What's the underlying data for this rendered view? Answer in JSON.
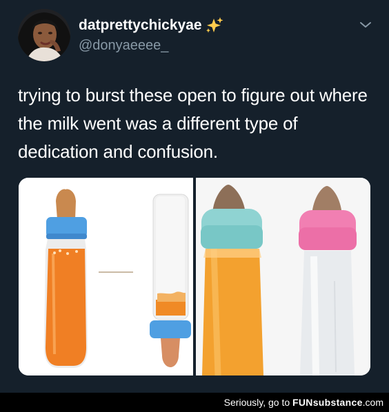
{
  "tweet": {
    "display_name": "datprettychickyae",
    "handle": "@donyaeeee_",
    "text": "trying to burst these open to figure out where the milk went was a different type of dedication and confusion.",
    "icons": [
      "sparkles-icon",
      "chevron-down-icon"
    ],
    "colors": {
      "background": "#15202b",
      "text": "#ffffff",
      "secondary_text": "#8899a6",
      "sparkles": "#ffcc4d"
    }
  },
  "footer": {
    "prefix": "Seriously, go to ",
    "brand": "FUNsubstance",
    "suffix": ".com"
  }
}
